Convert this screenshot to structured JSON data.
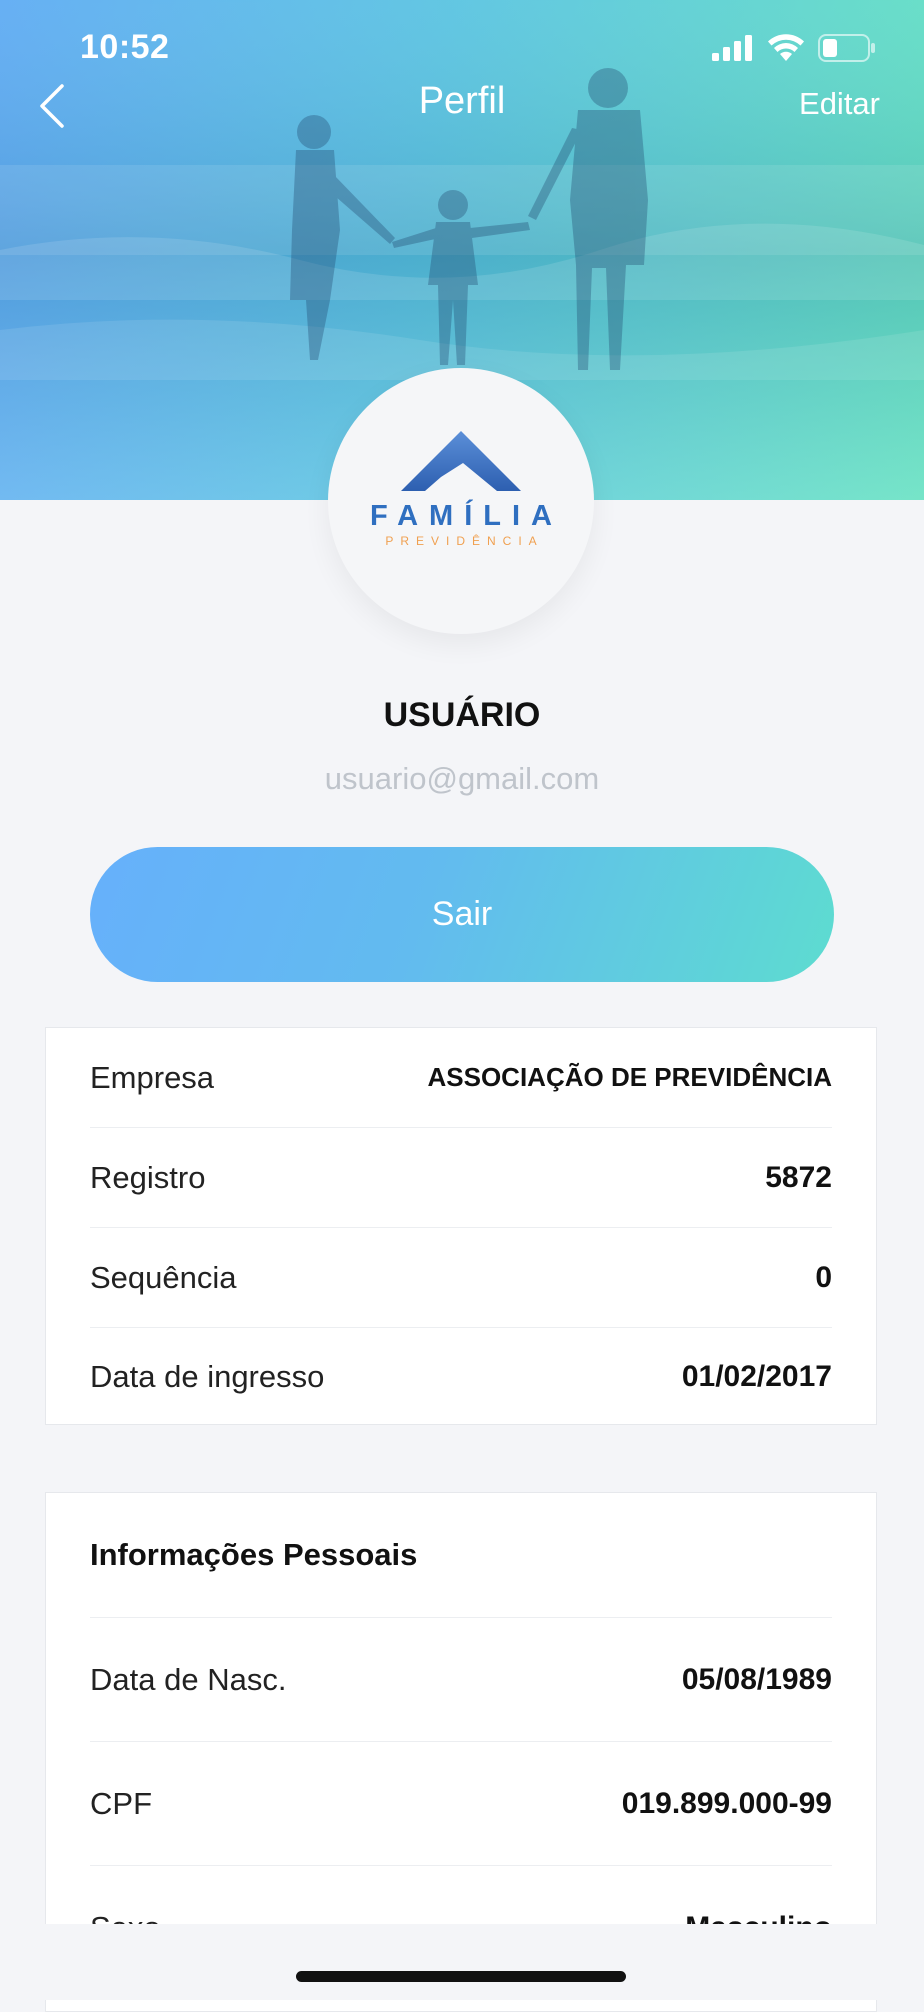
{
  "status_bar": {
    "time": "10:52"
  },
  "nav": {
    "title": "Perfil",
    "edit_label": "Editar"
  },
  "logo": {
    "word": "FAMÍLIA",
    "sub": "PREVIDÊNCIA"
  },
  "user": {
    "name": "USUÁRIO",
    "email": "usuario@gmail.com"
  },
  "logout_label": "Sair",
  "company_card": {
    "rows": [
      {
        "label": "Empresa",
        "value": "ASSOCIAÇÃO DE PREVIDÊNCIA"
      },
      {
        "label": "Registro",
        "value": "5872"
      },
      {
        "label": "Sequência",
        "value": "0"
      },
      {
        "label": "Data de ingresso",
        "value": "01/02/2017"
      }
    ]
  },
  "personal_card": {
    "title": "Informações Pessoais",
    "rows": [
      {
        "label": "Data de Nasc.",
        "value": "05/08/1989"
      },
      {
        "label": "CPF",
        "value": "019.899.000-99"
      },
      {
        "label": "Sexo",
        "value": "Masculino"
      }
    ]
  },
  "colors": {
    "header_gradient_start": "#5aa9f3",
    "header_gradient_end": "#5ee0bf",
    "button_gradient_start": "#66b0fb",
    "button_gradient_end": "#5ddcd0",
    "logo_blue": "#2f6fc0",
    "logo_orange": "#f0a050"
  }
}
